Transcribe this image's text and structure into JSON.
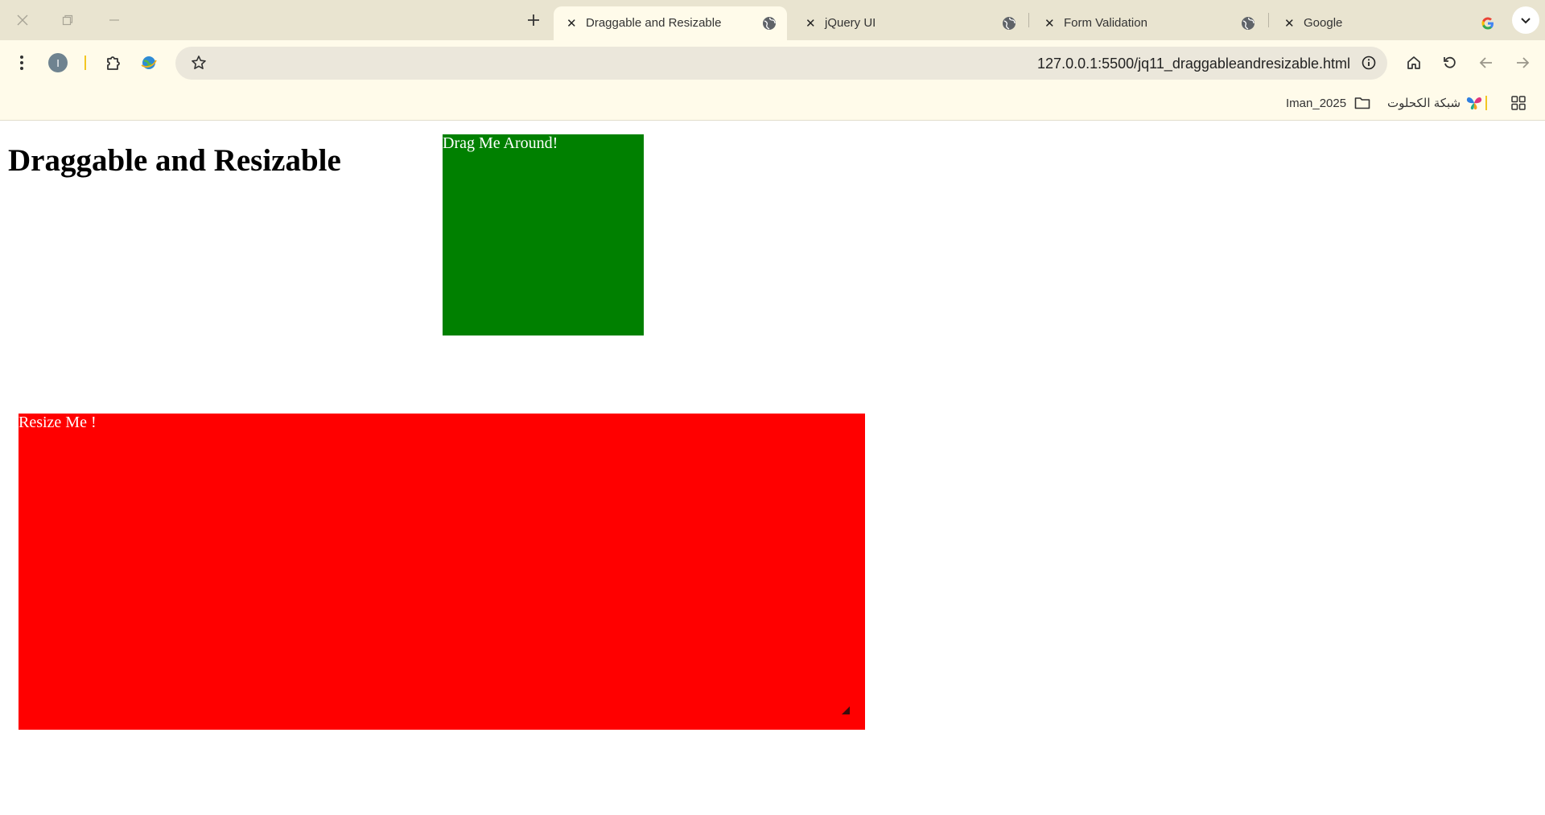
{
  "browser": {
    "tabs": [
      {
        "title": "Draggable and Resizable",
        "active": true
      },
      {
        "title": "jQuery UI",
        "active": false
      },
      {
        "title": "Form Validation",
        "active": false
      },
      {
        "title": "Google",
        "active": false
      }
    ],
    "new_tab_icon": "plus-icon",
    "url": "127.0.0.1:5500/jq11_draggableandresizable.html",
    "profile_initial": "I",
    "bookmarks": [
      {
        "label": "Iman_2025",
        "icon": "folder-icon"
      },
      {
        "label": "شبكة الكحلوت",
        "icon": "butterfly-icon"
      }
    ]
  },
  "page": {
    "heading": "Draggable and Resizable",
    "draggable_label": "Drag Me Around!",
    "resizable_label": "Resize Me !"
  },
  "colors": {
    "draggable_bg": "#008000",
    "resizable_bg": "#ff0000",
    "chrome_bg": "#fffbea",
    "tabbar_bg": "#e9e4d0"
  }
}
